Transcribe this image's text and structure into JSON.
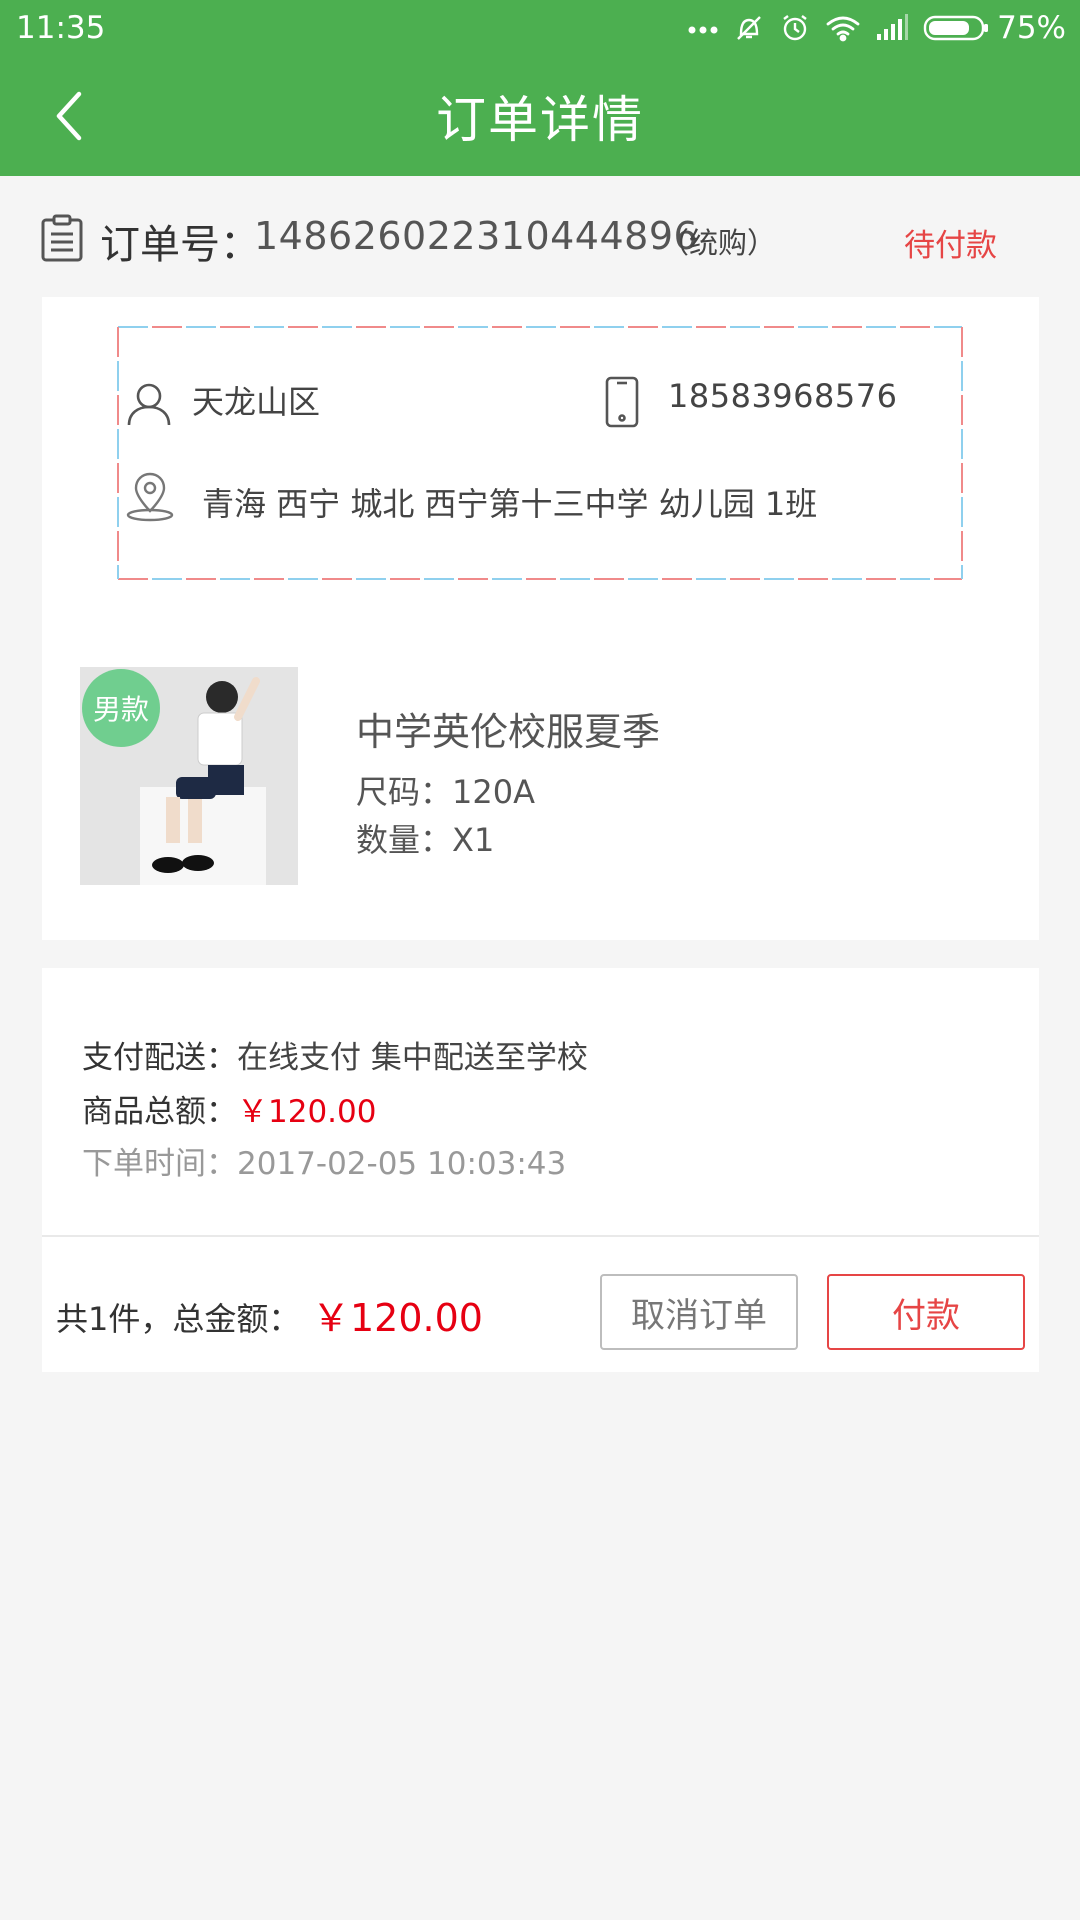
{
  "status_bar": {
    "time": "11:35",
    "battery_percent": "75%",
    "icons": [
      "more-dots-icon",
      "vibrate-off-icon",
      "alarm-icon",
      "wifi-icon",
      "signal-icon",
      "battery-icon"
    ]
  },
  "header": {
    "title": "订单详情",
    "back_icon": "chevron-left-icon"
  },
  "order": {
    "label": "订单号：",
    "number": "148626022310444896",
    "suffix": "（统购）",
    "status": "待付款"
  },
  "recipient": {
    "name": "天龙山区",
    "phone": "18583968576",
    "address": "青海 西宁 城北 西宁第十三中学 幼儿园 1班"
  },
  "product": {
    "badge": "男款",
    "name": "中学英伦校服夏季",
    "size_label": "尺码：",
    "size_value": "120A",
    "qty_label": "数量：",
    "qty_value": "X1"
  },
  "summary": {
    "pay_label": "支付配送：",
    "pay_value": "在线支付 集中配送至学校",
    "goods_total_label": "商品总额：",
    "goods_total_value": "￥120.00",
    "order_time_label": "下单时间：",
    "order_time_value": "2017-02-05 10:03:43"
  },
  "footer": {
    "count_label": "共1件，总金额：",
    "total_price": "￥120.00",
    "cancel_button": "取消订单",
    "pay_button": "付款"
  },
  "colors": {
    "primary_green": "#4caf50",
    "price_red": "#e60012",
    "status_red": "#e64545",
    "envelope_red": "#f08a8a",
    "envelope_blue": "#8fd0ee"
  }
}
